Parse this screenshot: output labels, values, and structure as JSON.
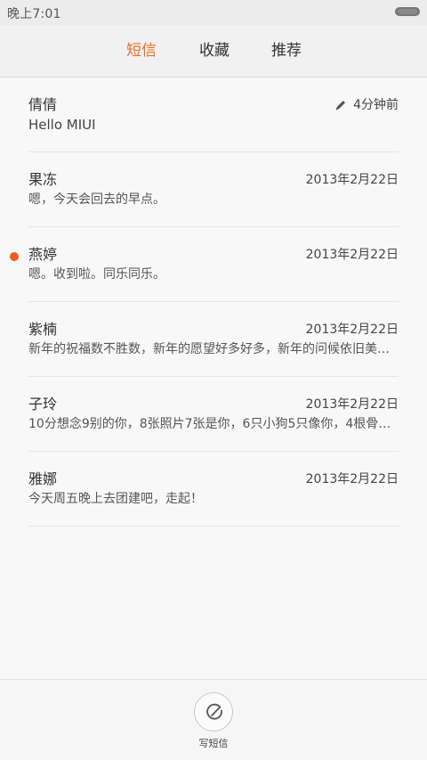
{
  "status_bar": {
    "time": "晚上7:01"
  },
  "tabs": [
    {
      "label": "短信",
      "active": true
    },
    {
      "label": "收藏",
      "active": false
    },
    {
      "label": "推荐",
      "active": false
    }
  ],
  "conversations": [
    {
      "name": "倩倩",
      "time": "4分钟前",
      "preview": "Hello MIUI",
      "draft": true,
      "unread": false
    },
    {
      "name": "果冻",
      "time": "2013年2月22日",
      "preview": "嗯，今天会回去的早点。",
      "draft": false,
      "unread": false
    },
    {
      "name": "燕婷",
      "time": "2013年2月22日",
      "preview": "嗯。收到啦。同乐同乐。",
      "draft": false,
      "unread": true
    },
    {
      "name": "紫楠",
      "time": "2013年2月22日",
      "preview": "新年的祝福数不胜数，新年的愿望好多好多，新年的问候依旧美好…",
      "draft": false,
      "unread": false
    },
    {
      "name": "子玲",
      "time": "2013年2月22日",
      "preview": "10分想念9别的你，8张照片7张是你，6只小狗5只像你，4根骨头…",
      "draft": false,
      "unread": false
    },
    {
      "name": "雅娜",
      "time": "2013年2月22日",
      "preview": "今天周五晚上去团建吧，走起！",
      "draft": false,
      "unread": false
    }
  ],
  "compose": {
    "label": "写短信",
    "icon": "compose-icon"
  },
  "colors": {
    "accent": "#f06a1f",
    "unread_dot": "#f25a1e"
  }
}
